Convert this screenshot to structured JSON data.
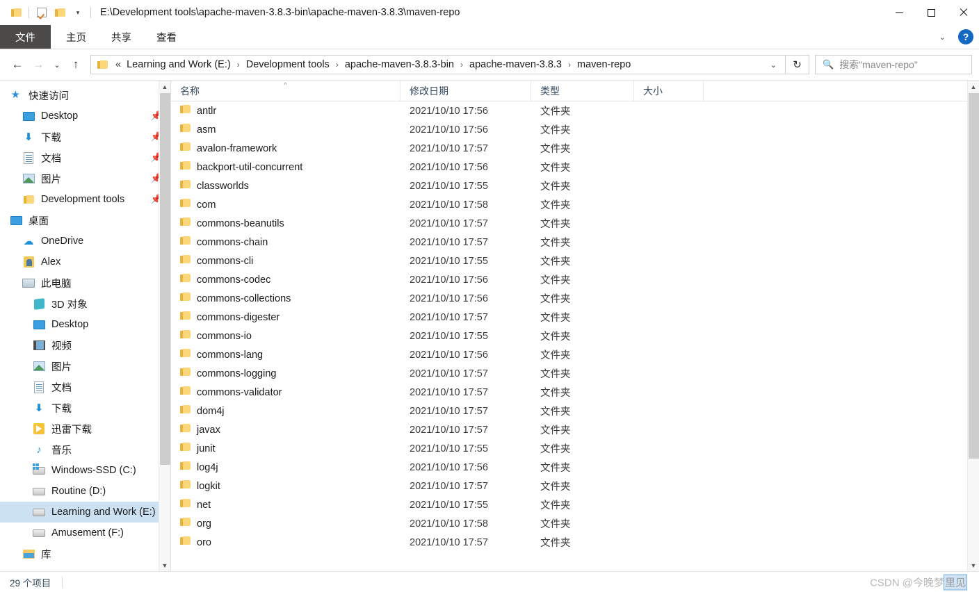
{
  "window": {
    "title_path": "E:\\Development tools\\apache-maven-3.8.3-bin\\apache-maven-3.8.3\\maven-repo",
    "minimize_label": "最小化",
    "maximize_label": "最大化",
    "close_label": "关闭"
  },
  "quick_access_toolbar": {
    "folder_icon": "folder-icon",
    "properties_icon": "properties-checkbox-icon",
    "new_folder_icon": "new-folder-icon",
    "customize_caret": "▾"
  },
  "ribbon": {
    "tabs": [
      {
        "label": "文件",
        "selected": true
      },
      {
        "label": "主页",
        "selected": false
      },
      {
        "label": "共享",
        "selected": false
      },
      {
        "label": "查看",
        "selected": false
      }
    ],
    "expand_caret": "⌄",
    "help_label": "?"
  },
  "navigation": {
    "back": "←",
    "forward": "→",
    "recent": "⌄",
    "up": "↑",
    "refresh": "↻",
    "address_caret": "⌄",
    "breadcrumb_prefix": "«",
    "breadcrumbs": [
      "Learning and Work (E:)",
      "Development tools",
      "apache-maven-3.8.3-bin",
      "apache-maven-3.8.3",
      "maven-repo"
    ],
    "separator": "›"
  },
  "search": {
    "icon": "search-icon",
    "placeholder": "搜索\"maven-repo\"",
    "value": ""
  },
  "sidebar": {
    "items": [
      {
        "label": "快速访问",
        "icon": "star-icon",
        "level": 0,
        "pinned": false,
        "selected": false
      },
      {
        "label": "Desktop",
        "icon": "monitor-icon",
        "level": 1,
        "pinned": true,
        "selected": false
      },
      {
        "label": "下载",
        "icon": "download-icon",
        "level": 1,
        "pinned": true,
        "selected": false
      },
      {
        "label": "文档",
        "icon": "document-icon",
        "level": 1,
        "pinned": true,
        "selected": false
      },
      {
        "label": "图片",
        "icon": "picture-icon",
        "level": 1,
        "pinned": true,
        "selected": false
      },
      {
        "label": "Development tools",
        "icon": "folder-icon",
        "level": 1,
        "pinned": true,
        "selected": false
      },
      {
        "label": "桌面",
        "icon": "monitor-icon",
        "level": 0,
        "pinned": false,
        "selected": false
      },
      {
        "label": "OneDrive",
        "icon": "cloud-icon",
        "level": 1,
        "pinned": false,
        "selected": false
      },
      {
        "label": "Alex",
        "icon": "user-folder-icon",
        "level": 1,
        "pinned": false,
        "selected": false
      },
      {
        "label": "此电脑",
        "icon": "this-pc-icon",
        "level": 1,
        "pinned": false,
        "selected": false
      },
      {
        "label": "3D 对象",
        "icon": "3d-objects-icon",
        "level": 2,
        "pinned": false,
        "selected": false
      },
      {
        "label": "Desktop",
        "icon": "monitor-icon",
        "level": 2,
        "pinned": false,
        "selected": false
      },
      {
        "label": "视频",
        "icon": "videos-icon",
        "level": 2,
        "pinned": false,
        "selected": false
      },
      {
        "label": "图片",
        "icon": "picture-icon",
        "level": 2,
        "pinned": false,
        "selected": false
      },
      {
        "label": "文档",
        "icon": "document-icon",
        "level": 2,
        "pinned": false,
        "selected": false
      },
      {
        "label": "下载",
        "icon": "download-icon",
        "level": 2,
        "pinned": false,
        "selected": false
      },
      {
        "label": "迅雷下载",
        "icon": "thunder-icon",
        "level": 2,
        "pinned": false,
        "selected": false
      },
      {
        "label": "音乐",
        "icon": "music-icon",
        "level": 2,
        "pinned": false,
        "selected": false
      },
      {
        "label": "Windows-SSD (C:)",
        "icon": "windows-drive-icon",
        "level": 2,
        "pinned": false,
        "selected": false
      },
      {
        "label": "Routine (D:)",
        "icon": "drive-icon",
        "level": 2,
        "pinned": false,
        "selected": false
      },
      {
        "label": "Learning and Work (E:)",
        "icon": "drive-icon",
        "level": 2,
        "pinned": false,
        "selected": true
      },
      {
        "label": "Amusement (F:)",
        "icon": "drive-icon",
        "level": 2,
        "pinned": false,
        "selected": false
      },
      {
        "label": "库",
        "icon": "library-icon",
        "level": 1,
        "pinned": false,
        "selected": false
      }
    ]
  },
  "file_list": {
    "columns": [
      {
        "label": "名称",
        "sorted": true,
        "sort_arrow": "^"
      },
      {
        "label": "修改日期",
        "sorted": false,
        "sort_arrow": ""
      },
      {
        "label": "类型",
        "sorted": false,
        "sort_arrow": ""
      },
      {
        "label": "大小",
        "sorted": false,
        "sort_arrow": ""
      }
    ],
    "rows": [
      {
        "name": "antlr",
        "date": "2021/10/10 17:56",
        "type": "文件夹",
        "size": ""
      },
      {
        "name": "asm",
        "date": "2021/10/10 17:56",
        "type": "文件夹",
        "size": ""
      },
      {
        "name": "avalon-framework",
        "date": "2021/10/10 17:57",
        "type": "文件夹",
        "size": ""
      },
      {
        "name": "backport-util-concurrent",
        "date": "2021/10/10 17:56",
        "type": "文件夹",
        "size": ""
      },
      {
        "name": "classworlds",
        "date": "2021/10/10 17:55",
        "type": "文件夹",
        "size": ""
      },
      {
        "name": "com",
        "date": "2021/10/10 17:58",
        "type": "文件夹",
        "size": ""
      },
      {
        "name": "commons-beanutils",
        "date": "2021/10/10 17:57",
        "type": "文件夹",
        "size": ""
      },
      {
        "name": "commons-chain",
        "date": "2021/10/10 17:57",
        "type": "文件夹",
        "size": ""
      },
      {
        "name": "commons-cli",
        "date": "2021/10/10 17:55",
        "type": "文件夹",
        "size": ""
      },
      {
        "name": "commons-codec",
        "date": "2021/10/10 17:56",
        "type": "文件夹",
        "size": ""
      },
      {
        "name": "commons-collections",
        "date": "2021/10/10 17:56",
        "type": "文件夹",
        "size": ""
      },
      {
        "name": "commons-digester",
        "date": "2021/10/10 17:57",
        "type": "文件夹",
        "size": ""
      },
      {
        "name": "commons-io",
        "date": "2021/10/10 17:55",
        "type": "文件夹",
        "size": ""
      },
      {
        "name": "commons-lang",
        "date": "2021/10/10 17:56",
        "type": "文件夹",
        "size": ""
      },
      {
        "name": "commons-logging",
        "date": "2021/10/10 17:57",
        "type": "文件夹",
        "size": ""
      },
      {
        "name": "commons-validator",
        "date": "2021/10/10 17:57",
        "type": "文件夹",
        "size": ""
      },
      {
        "name": "dom4j",
        "date": "2021/10/10 17:57",
        "type": "文件夹",
        "size": ""
      },
      {
        "name": "javax",
        "date": "2021/10/10 17:57",
        "type": "文件夹",
        "size": ""
      },
      {
        "name": "junit",
        "date": "2021/10/10 17:55",
        "type": "文件夹",
        "size": ""
      },
      {
        "name": "log4j",
        "date": "2021/10/10 17:56",
        "type": "文件夹",
        "size": ""
      },
      {
        "name": "logkit",
        "date": "2021/10/10 17:57",
        "type": "文件夹",
        "size": ""
      },
      {
        "name": "net",
        "date": "2021/10/10 17:55",
        "type": "文件夹",
        "size": ""
      },
      {
        "name": "org",
        "date": "2021/10/10 17:58",
        "type": "文件夹",
        "size": ""
      },
      {
        "name": "oro",
        "date": "2021/10/10 17:57",
        "type": "文件夹",
        "size": ""
      }
    ]
  },
  "statusbar": {
    "item_count": "29 个项目"
  },
  "watermark": {
    "prefix": "CSDN @今晚梦",
    "selected": "里见"
  }
}
